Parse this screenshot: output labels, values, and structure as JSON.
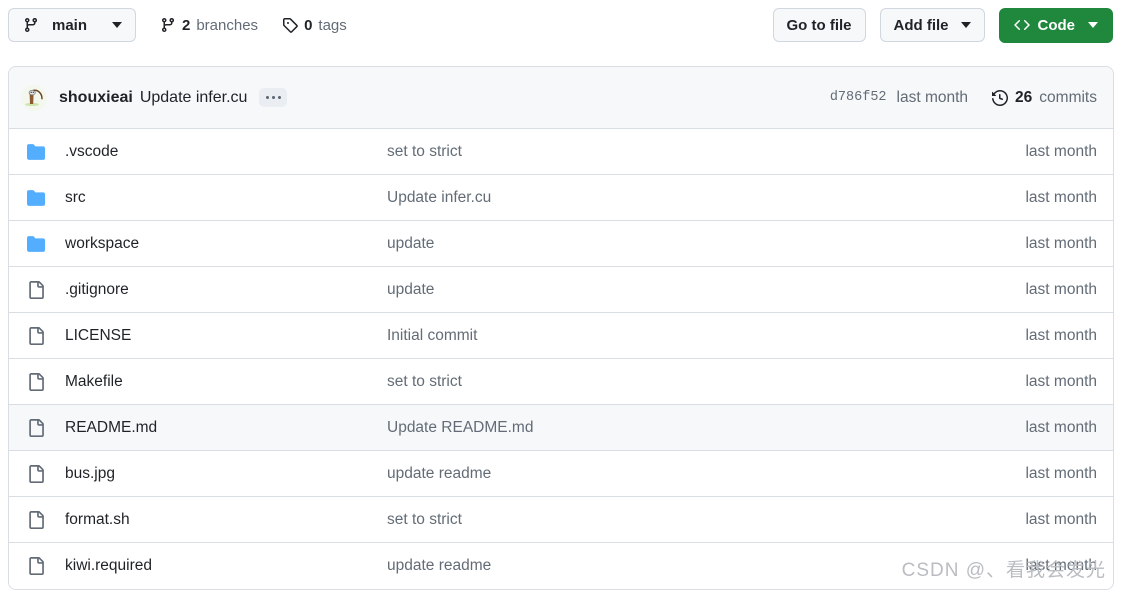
{
  "toolbar": {
    "branch_button": {
      "label": "main",
      "icon": "git-branch-icon"
    },
    "branches": {
      "count": "2",
      "label": "branches",
      "icon": "git-branch-icon"
    },
    "tags": {
      "count": "0",
      "label": "tags",
      "icon": "tag-icon"
    },
    "go_to_file": "Go to file",
    "add_file": "Add file",
    "code": "Code"
  },
  "commit_header": {
    "author": "shouxieai",
    "message": "Update infer.cu",
    "kebab_label": "...",
    "sha": "d786f52",
    "when": "last month",
    "commits_count": "26",
    "commits_label": "commits",
    "history_icon": "history-clock-icon"
  },
  "files": [
    {
      "type": "folder",
      "name": ".vscode",
      "message": "set to strict",
      "time": "last month",
      "highlight": false
    },
    {
      "type": "folder",
      "name": "src",
      "message": "Update infer.cu",
      "time": "last month",
      "highlight": false
    },
    {
      "type": "folder",
      "name": "workspace",
      "message": "update",
      "time": "last month",
      "highlight": false
    },
    {
      "type": "file",
      "name": ".gitignore",
      "message": "update",
      "time": "last month",
      "highlight": false
    },
    {
      "type": "file",
      "name": "LICENSE",
      "message": "Initial commit",
      "time": "last month",
      "highlight": false
    },
    {
      "type": "file",
      "name": "Makefile",
      "message": "set to strict",
      "time": "last month",
      "highlight": false
    },
    {
      "type": "file",
      "name": "README.md",
      "message": "Update README.md",
      "time": "last month",
      "highlight": true
    },
    {
      "type": "file",
      "name": "bus.jpg",
      "message": "update readme",
      "time": "last month",
      "highlight": false
    },
    {
      "type": "file",
      "name": "format.sh",
      "message": "set to strict",
      "time": "last month",
      "highlight": false
    },
    {
      "type": "file",
      "name": "kiwi.required",
      "message": "update readme",
      "time": "last month",
      "highlight": false
    }
  ],
  "watermark": "CSDN @、看我会发光",
  "colors": {
    "code_button_green": "#1f883d",
    "folder_blue": "#54aeff",
    "border": "#d8dee4",
    "header_bg": "#f6f8fa",
    "text": "#1f2328",
    "muted_text": "#636c76"
  }
}
